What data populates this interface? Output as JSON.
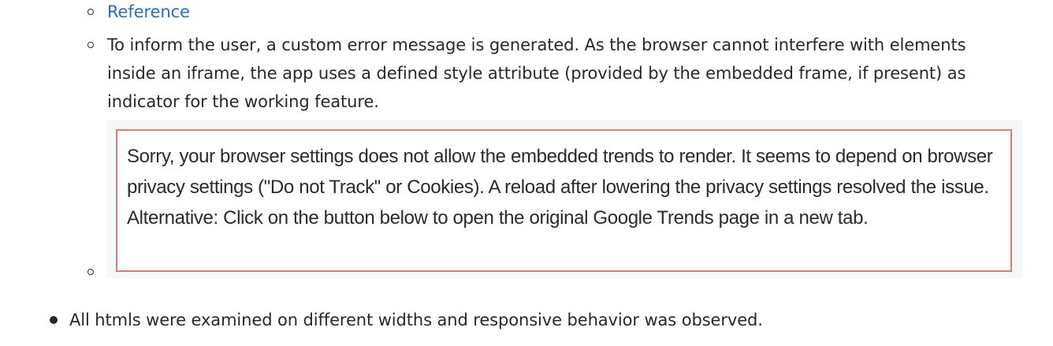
{
  "sub_items": {
    "reference_link": "Reference",
    "paragraph": "To inform the user, a custom error message is generated. As the browser cannot interfere with elements inside an iframe, the app uses a defined style attribute (provided by the embedded frame, if present) as indicator for the working feature.",
    "notice": "Sorry, your browser settings does not allow the embedded trends to render. It seems to depend on browser privacy settings (\"Do not Track\" or Cookies). A reload after lowering the privacy settings resolved the issue. Alternative: Click on the button below to open the original Google Trends page in a new tab."
  },
  "main_item": "All htmls were examined on different widths and responsive behavior was observed.",
  "colors": {
    "text": "#24292f",
    "link": "#2a6ebb",
    "notice_border": "#e07a7a",
    "frame_background": "#f6f7f8"
  }
}
